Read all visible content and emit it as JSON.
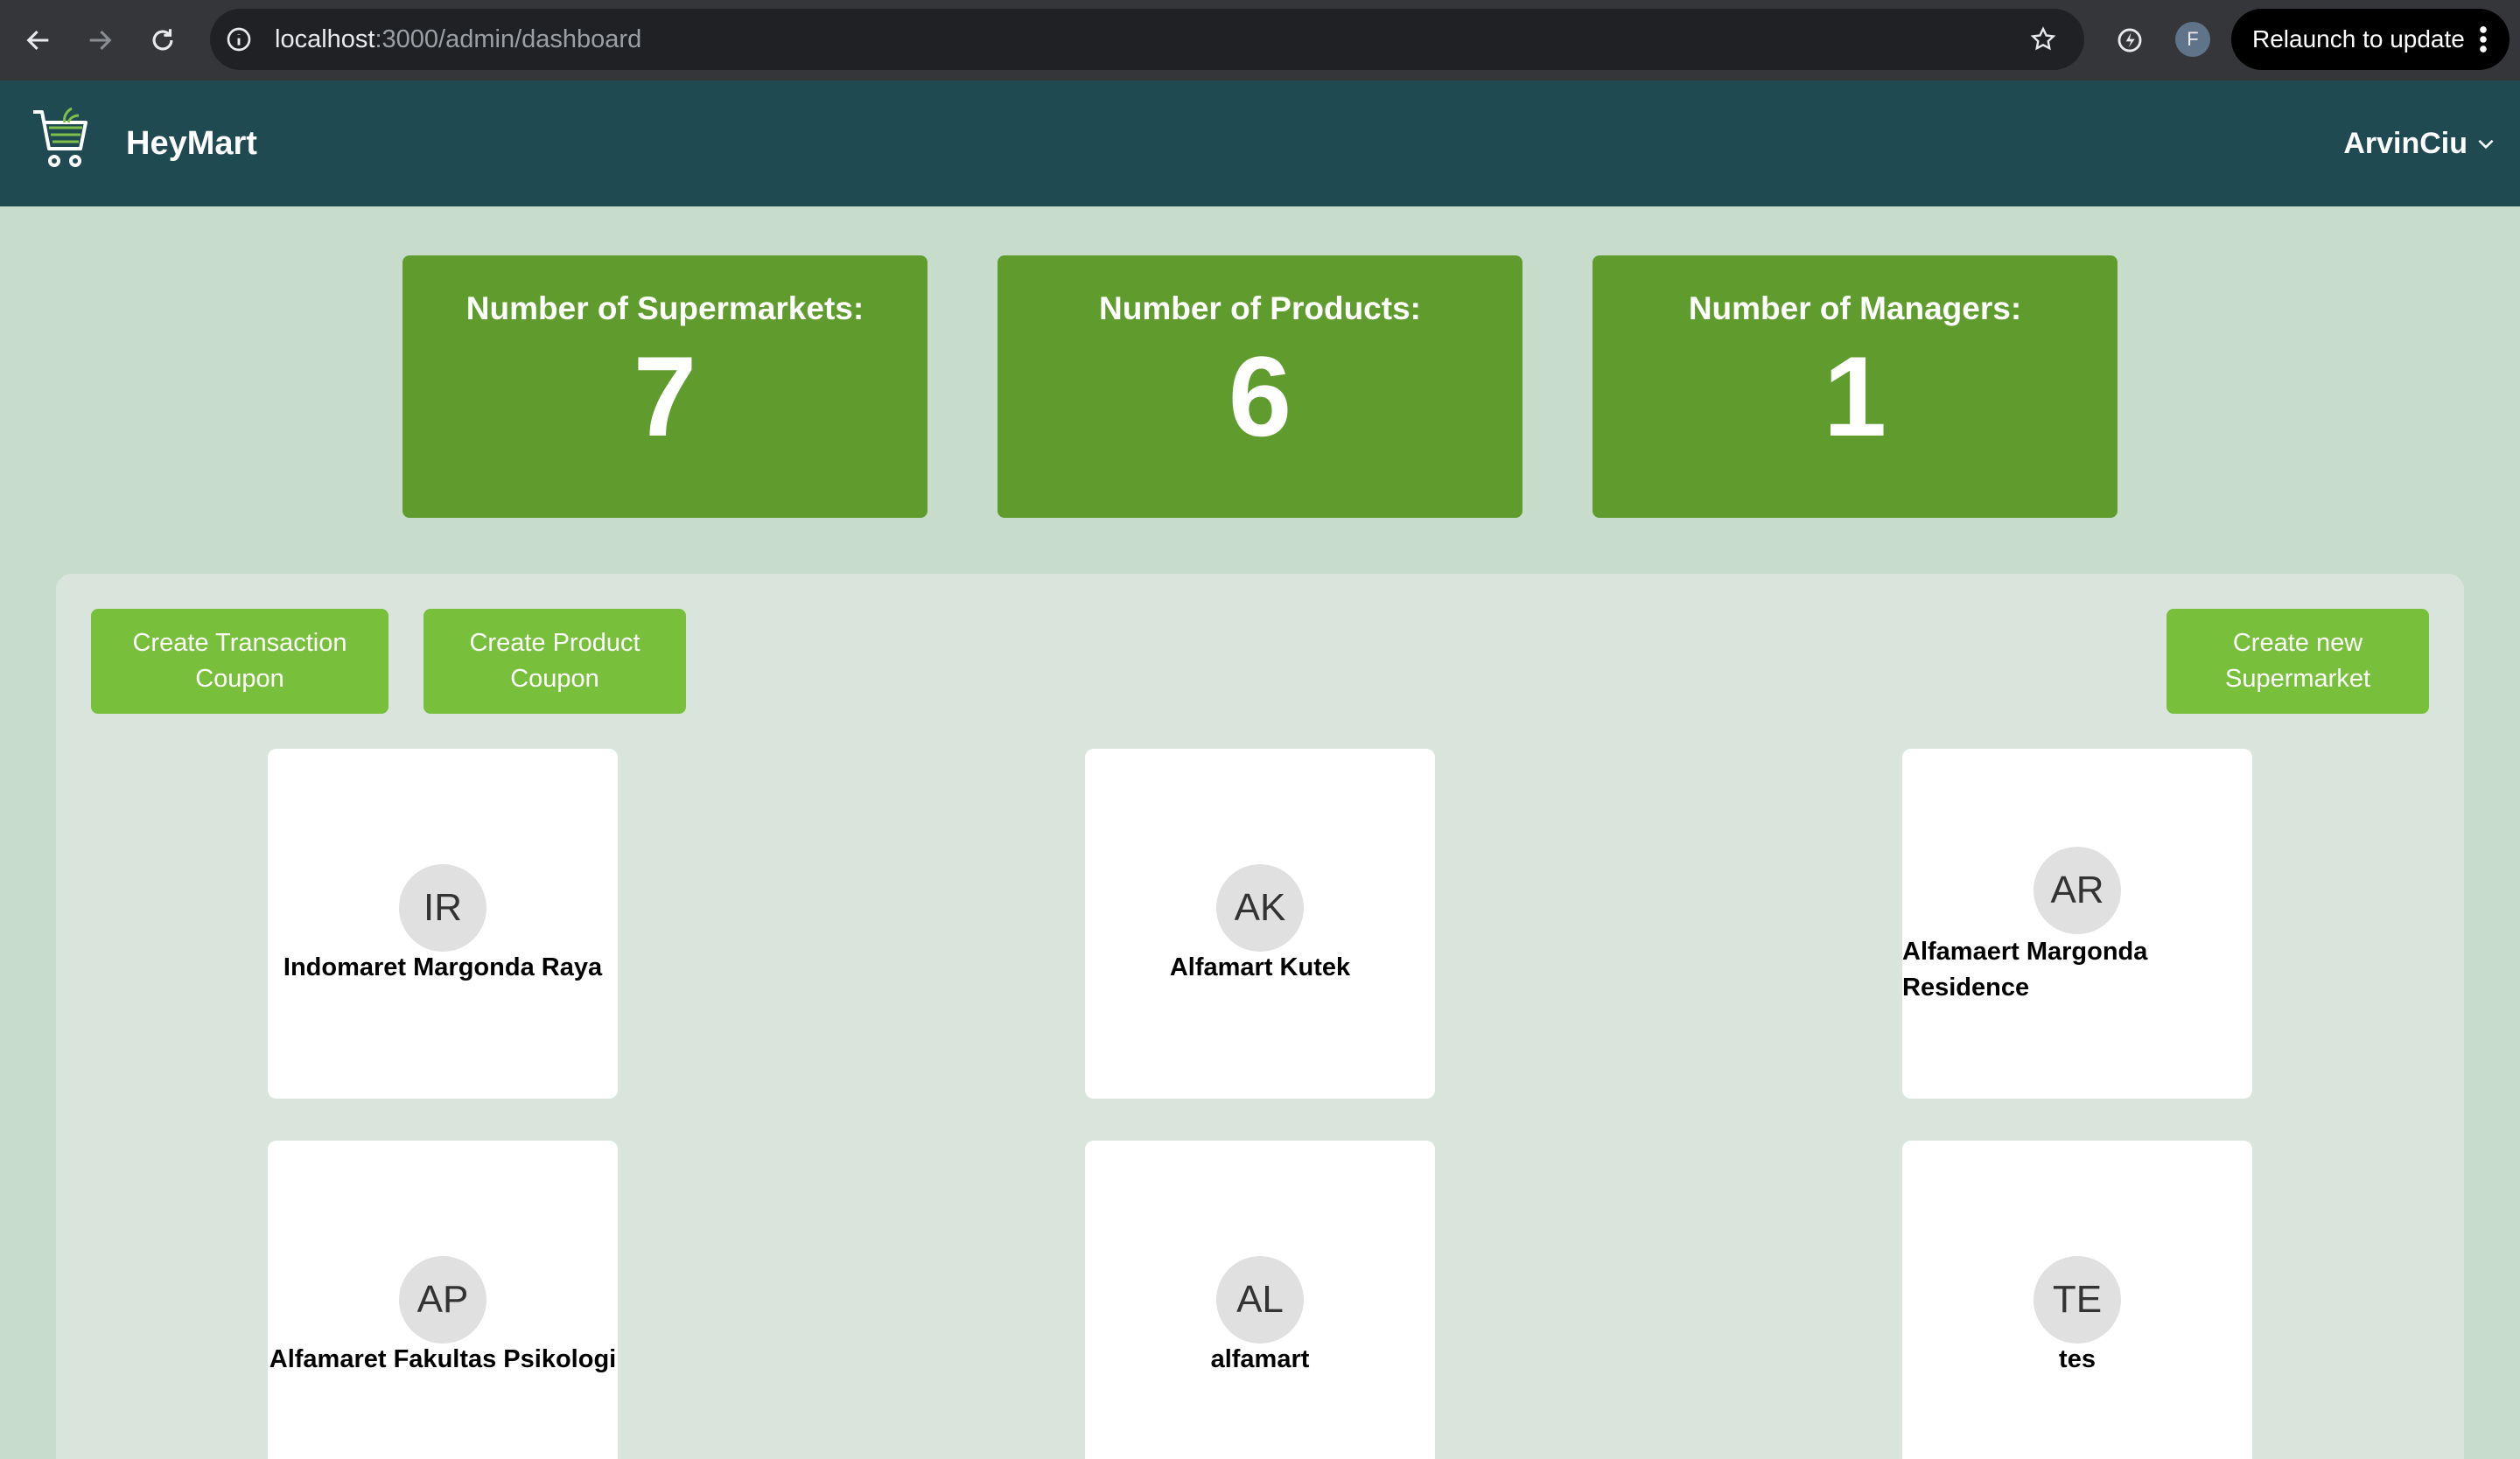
{
  "browser": {
    "url_host": "localhost",
    "url_path": ":3000/admin/dashboard",
    "profile_initial": "F",
    "relaunch_label": "Relaunch to update"
  },
  "header": {
    "brand": "HeyMart",
    "user_name": "ArvinCiu",
    "logo_icon": "cart-logo-icon",
    "colors": {
      "header_bg": "#204a52",
      "page_bg": "#c8dccb"
    }
  },
  "stats": [
    {
      "label": "Number of Supermarkets:",
      "value": "7"
    },
    {
      "label": "Number of Products:",
      "value": "6"
    },
    {
      "label": "Number of Managers:",
      "value": "1"
    }
  ],
  "actions": {
    "transaction_coupon": "Create Transaction Coupon",
    "product_coupon": "Create Product Coupon",
    "new_supermarket": "Create new Supermarket"
  },
  "supermarkets": [
    {
      "initials": "IR",
      "name": "Indomaret Margonda Raya"
    },
    {
      "initials": "AK",
      "name": "Alfamart Kutek"
    },
    {
      "initials": "AR",
      "name": "Alfamaert Margonda Residence"
    },
    {
      "initials": "AP",
      "name": "Alfamaret Fakultas Psikologi"
    },
    {
      "initials": "AL",
      "name": "alfamart"
    },
    {
      "initials": "TE",
      "name": "tes"
    }
  ],
  "colors": {
    "stat_bg": "#5f9c2d",
    "button_bg": "#78c03c",
    "panel_bg": "#d9e5dc"
  }
}
